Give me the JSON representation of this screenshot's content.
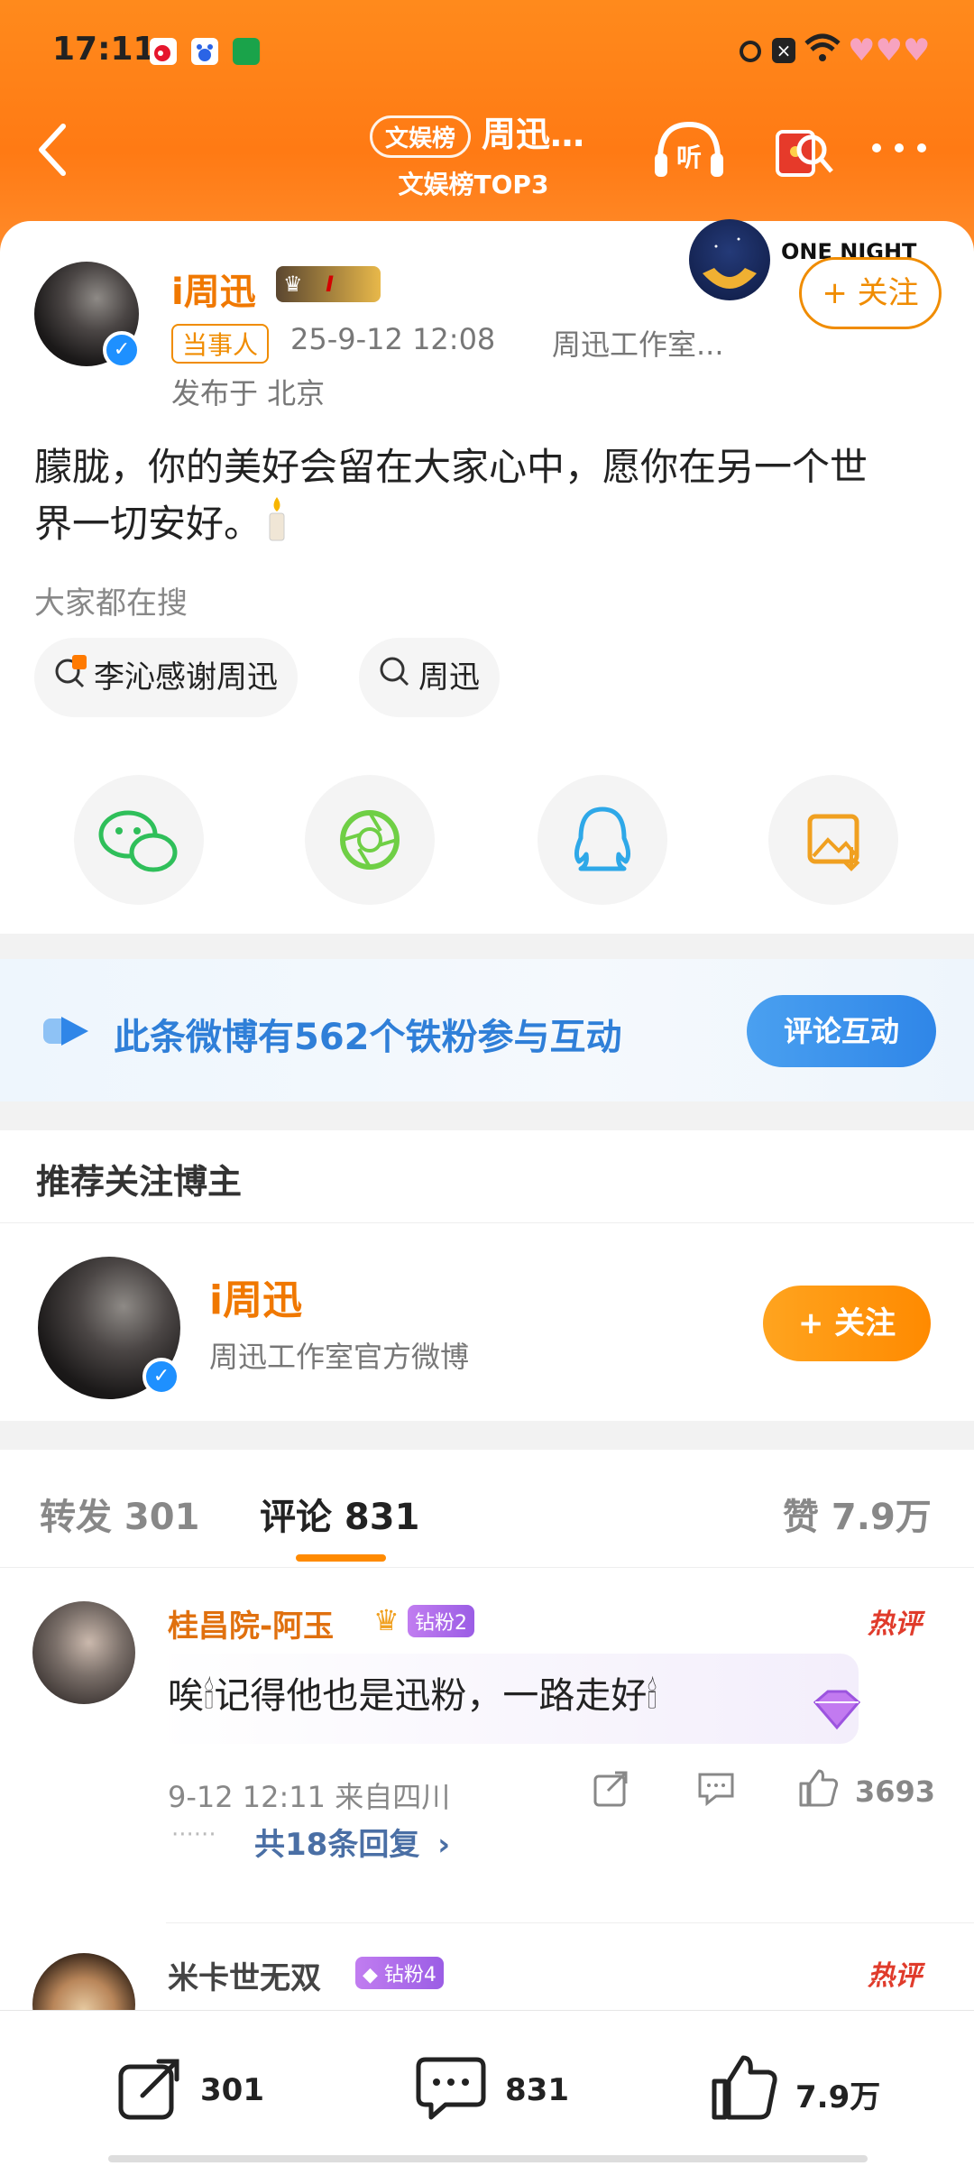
{
  "status": {
    "time": "17:11",
    "app_icons": [
      "weibo-app-icon",
      "baidu-app-icon",
      "game-app-icon"
    ],
    "right_icons": [
      "alarm-icon",
      "notification-x-icon",
      "wifi-icon",
      "hearts-icon"
    ]
  },
  "nav": {
    "tag": "文娱榜",
    "name": "周迅…",
    "sub": "文娱榜TOP3"
  },
  "post": {
    "author": "i周迅",
    "badge": "I",
    "role_tag": "当事人",
    "time": "25-9-12 12:08",
    "source": "周迅工作室...",
    "location": "发布于 北京",
    "follow_label": "+ 关注",
    "ad_label": "ONE NIGHT",
    "content_line1": "朦胧，你的美好会留在大家心中，愿你在另一个世",
    "content_line2": "界一切安好。",
    "search_title": "大家都在搜",
    "chips": [
      {
        "label": "李沁感谢周迅",
        "hot": "热"
      },
      {
        "label": "周迅"
      }
    ],
    "share_targets": [
      "wechat",
      "moments",
      "qq",
      "save-image"
    ]
  },
  "fans": {
    "text": "此条微博有562个铁粉参与互动",
    "button": "评论互动"
  },
  "recommend": {
    "title": "推荐关注博主",
    "name": "i周迅",
    "desc": "周迅工作室官方微博",
    "follow": "+ 关注"
  },
  "tabs": {
    "repost": "转发 301",
    "comment": "评论 831",
    "like": "赞 7.9万"
  },
  "comments": [
    {
      "name": "桂昌院-阿玉",
      "badge": "钻粉2",
      "hot": "热评",
      "text": "唉🕯记得他也是迅粉，一路走好🕯",
      "meta": "9-12 12:11  来自四川",
      "likes": "3693",
      "replies": "共18条回复",
      "dots": "······"
    },
    {
      "name": "米卡世无双",
      "badge": "钻粉4",
      "hot": "热评"
    }
  ],
  "bottom": {
    "repost": "301",
    "comment": "831",
    "like": "7.9万"
  }
}
